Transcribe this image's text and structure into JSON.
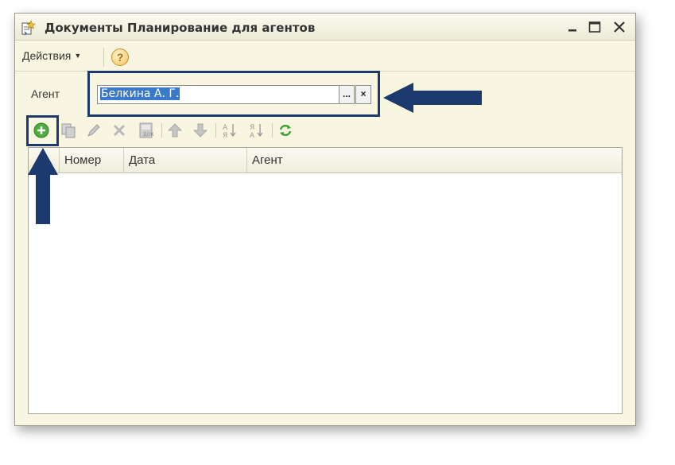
{
  "window": {
    "title": "Документы Планирование для агентов",
    "icon": "document-star-icon"
  },
  "menubar": {
    "actions_label": "Действия",
    "help_icon": "?"
  },
  "agent": {
    "label": "Агент",
    "value": "Белкина А. Г.",
    "select_button": "...",
    "clear_button": "×"
  },
  "toolbar": {
    "buttons": [
      "add-icon",
      "copy-icon",
      "edit-icon",
      "delete-icon",
      "post-icon",
      "move-up-icon",
      "move-down-icon",
      "sort-asc-icon",
      "sort-desc-icon",
      "refresh-icon"
    ]
  },
  "grid": {
    "columns": [
      "Номер",
      "Дата",
      "Агент"
    ],
    "rows": []
  },
  "colors": {
    "window_bg": "#f8f6e0",
    "highlight": "#1d3a6e",
    "selection": "#3a78c8"
  }
}
